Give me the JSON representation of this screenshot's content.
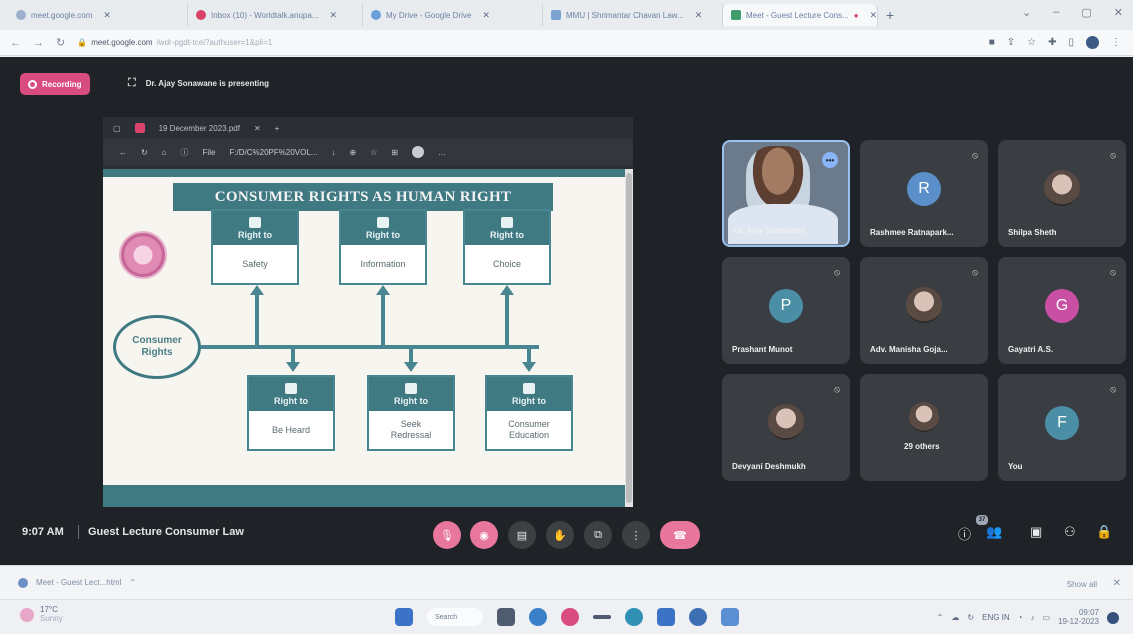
{
  "browser": {
    "tabs": [
      {
        "label": "meet.google.com"
      },
      {
        "label": "Inbox (10) - Worldtalk.anupa..."
      },
      {
        "label": "My Drive - Google Drive"
      },
      {
        "label": "MMU | Shrimantar Chavan Law..."
      },
      {
        "label": "Meet - Guest Lecture Cons...",
        "active": true
      }
    ],
    "url_host": "meet.google.com",
    "url_path": "/wdr-pgdt-tcei?authuser=1&pli=1",
    "window_controls": [
      "⌄",
      "–",
      "▢",
      "✕"
    ]
  },
  "meet": {
    "recording_label": "Recording",
    "presenting_text": "Dr. Ajay Sonawane is presenting",
    "shared_window": {
      "tab_label": "19 December 2023.pdf",
      "address_prefix": "File",
      "address_path": "F:/D/C%20PF%20VOL..."
    },
    "slide": {
      "title": "CONSUMER RIGHTS AS HUMAN RIGHT",
      "center_label_line1": "Consumer",
      "center_label_line2": "Rights",
      "rights_top": [
        {
          "head": "Right to",
          "body": "Safety"
        },
        {
          "head": "Right to",
          "body": "Information"
        },
        {
          "head": "Right to",
          "body": "Choice"
        }
      ],
      "rights_bottom": [
        {
          "head": "Right to",
          "body": "Be Heard"
        },
        {
          "head": "Right to",
          "body": "Seek Redressal"
        },
        {
          "head": "Right to",
          "body": "Consumer Education"
        }
      ]
    },
    "participants": [
      {
        "name": "Dr. Ajay Sonawane",
        "type": "camera"
      },
      {
        "name": "Rashmee Ratnapark...",
        "initial": "R",
        "color": "#5b8fc9"
      },
      {
        "name": "Shilpa Sheth",
        "type": "photo"
      },
      {
        "name": "Prashant Munot",
        "initial": "P",
        "color": "#4b8fa6"
      },
      {
        "name": "Adv. Manisha Goja...",
        "type": "photo"
      },
      {
        "name": "Gayatri A.S.",
        "initial": "G",
        "color": "#c94fa5"
      },
      {
        "name": "Devyani Deshmukh",
        "type": "photo"
      },
      {
        "name": "29 others",
        "type": "group"
      },
      {
        "name": "You",
        "initial": "F",
        "color": "#4b8fa6"
      }
    ],
    "time": "9:07 AM",
    "meeting_title": "Guest Lecture Consumer Law",
    "people_count": "37"
  },
  "downloads": {
    "item": "Meet - Guest Lect...html",
    "show_all": "Show all"
  },
  "taskbar": {
    "temperature": "17°C",
    "weather": "Sunny",
    "search": "Search",
    "lang": "ENG IN",
    "time": "09:07",
    "date": "19-12-2023"
  }
}
